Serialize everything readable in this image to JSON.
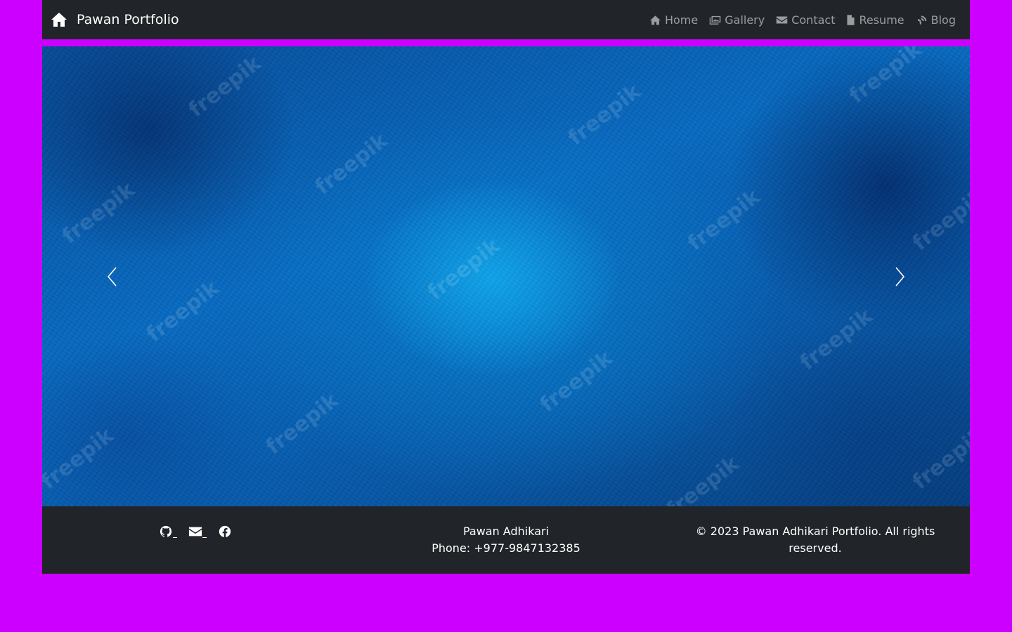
{
  "navbar": {
    "brand_icon": "home-icon",
    "brand": "Pawan Portfolio",
    "links": [
      {
        "icon": "home-icon",
        "label": "Home"
      },
      {
        "icon": "image-icon",
        "label": "Gallery"
      },
      {
        "icon": "envelope-icon",
        "label": "Contact"
      },
      {
        "icon": "file-icon",
        "label": "Resume"
      },
      {
        "icon": "blog-icon",
        "label": "Blog"
      }
    ]
  },
  "carousel": {
    "background": "blue textured wall",
    "watermark_text": "freepik",
    "prev_icon": "chevron-left-icon",
    "next_icon": "chevron-right-icon"
  },
  "footer": {
    "social_icons": [
      "github-icon",
      "envelope-icon",
      "facebook-icon"
    ],
    "name": "Pawan Adhikari",
    "phone": "Phone: +977-9847132385",
    "copyright": "© 2023 Pawan Adhikari Portfolio. All rights reserved."
  },
  "colors": {
    "page_background": "#cc00ff",
    "navbar_background": "#212529",
    "footer_background": "#212529",
    "link_muted": "rgba(255,255,255,0.55)"
  }
}
